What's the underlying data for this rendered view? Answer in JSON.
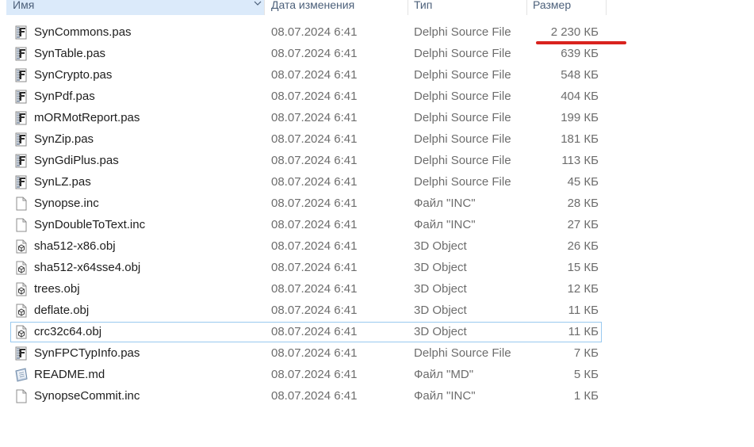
{
  "columns": {
    "name": "Имя",
    "date": "Дата изменения",
    "type": "Тип",
    "size": "Размер"
  },
  "accent_underline_color": "#d9231e",
  "files": [
    {
      "name": "SynCommons.pas",
      "date": "08.07.2024 6:41",
      "type": "Delphi Source File",
      "size": "2 230 КБ",
      "icon": "delphi-file-icon"
    },
    {
      "name": "SynTable.pas",
      "date": "08.07.2024 6:41",
      "type": "Delphi Source File",
      "size": "639 КБ",
      "icon": "delphi-file-icon"
    },
    {
      "name": "SynCrypto.pas",
      "date": "08.07.2024 6:41",
      "type": "Delphi Source File",
      "size": "548 КБ",
      "icon": "delphi-file-icon"
    },
    {
      "name": "SynPdf.pas",
      "date": "08.07.2024 6:41",
      "type": "Delphi Source File",
      "size": "404 КБ",
      "icon": "delphi-file-icon"
    },
    {
      "name": "mORMotReport.pas",
      "date": "08.07.2024 6:41",
      "type": "Delphi Source File",
      "size": "199 КБ",
      "icon": "delphi-file-icon"
    },
    {
      "name": "SynZip.pas",
      "date": "08.07.2024 6:41",
      "type": "Delphi Source File",
      "size": "181 КБ",
      "icon": "delphi-file-icon"
    },
    {
      "name": "SynGdiPlus.pas",
      "date": "08.07.2024 6:41",
      "type": "Delphi Source File",
      "size": "113 КБ",
      "icon": "delphi-file-icon"
    },
    {
      "name": "SynLZ.pas",
      "date": "08.07.2024 6:41",
      "type": "Delphi Source File",
      "size": "45 КБ",
      "icon": "delphi-file-icon"
    },
    {
      "name": "Synopse.inc",
      "date": "08.07.2024 6:41",
      "type": "Файл \"INC\"",
      "size": "28 КБ",
      "icon": "blank-file-icon"
    },
    {
      "name": "SynDoubleToText.inc",
      "date": "08.07.2024 6:41",
      "type": "Файл \"INC\"",
      "size": "27 КБ",
      "icon": "blank-file-icon"
    },
    {
      "name": "sha512-x86.obj",
      "date": "08.07.2024 6:41",
      "type": "3D Object",
      "size": "26 КБ",
      "icon": "3d-object-file-icon"
    },
    {
      "name": "sha512-x64sse4.obj",
      "date": "08.07.2024 6:41",
      "type": "3D Object",
      "size": "15 КБ",
      "icon": "3d-object-file-icon"
    },
    {
      "name": "trees.obj",
      "date": "08.07.2024 6:41",
      "type": "3D Object",
      "size": "12 КБ",
      "icon": "3d-object-file-icon"
    },
    {
      "name": "deflate.obj",
      "date": "08.07.2024 6:41",
      "type": "3D Object",
      "size": "11 КБ",
      "icon": "3d-object-file-icon"
    },
    {
      "name": "crc32c64.obj",
      "date": "08.07.2024 6:41",
      "type": "3D Object",
      "size": "11 КБ",
      "icon": "3d-object-file-icon",
      "selected": true
    },
    {
      "name": "SynFPCTypInfo.pas",
      "date": "08.07.2024 6:41",
      "type": "Delphi Source File",
      "size": "7 КБ",
      "icon": "delphi-file-icon"
    },
    {
      "name": "README.md",
      "date": "08.07.2024 6:41",
      "type": "Файл \"MD\"",
      "size": "5 КБ",
      "icon": "markdown-file-icon"
    },
    {
      "name": "SynopseCommit.inc",
      "date": "08.07.2024 6:41",
      "type": "Файл \"INC\"",
      "size": "1 КБ",
      "icon": "blank-file-icon"
    }
  ]
}
